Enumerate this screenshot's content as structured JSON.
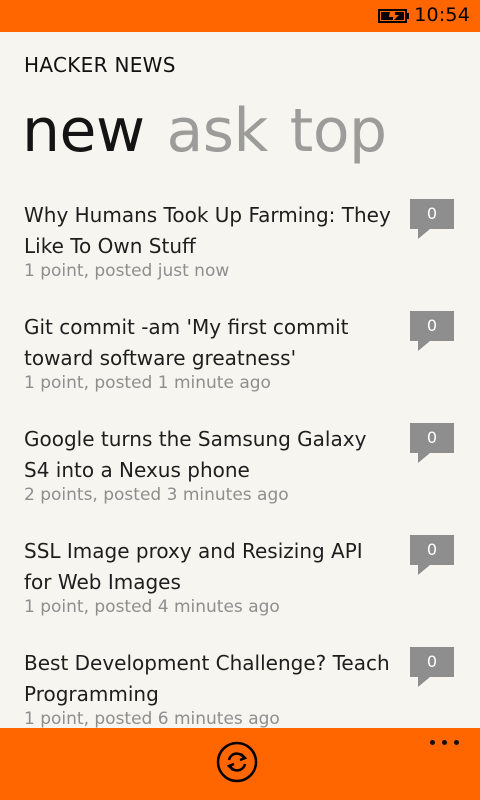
{
  "status_bar": {
    "time": "10:54",
    "battery_icon": "battery-charging-icon",
    "background": "#ff6600"
  },
  "app": {
    "title": "HACKER NEWS"
  },
  "pivot": {
    "tabs": [
      {
        "label": "new",
        "active": true
      },
      {
        "label": "ask",
        "active": false
      },
      {
        "label": "top",
        "active": false
      }
    ]
  },
  "stories": [
    {
      "title": "Why Humans Took Up Farming: They Like To Own Stuff",
      "meta": "1 point, posted just now",
      "comments": "0"
    },
    {
      "title": "Git commit -am 'My first commit toward software greatness'",
      "meta": "1 point, posted 1 minute ago",
      "comments": "0"
    },
    {
      "title": "Google turns the Samsung Galaxy S4 into a Nexus phone",
      "meta": "2 points, posted 3 minutes ago",
      "comments": "0"
    },
    {
      "title": "SSL Image proxy and Resizing API for Web Images",
      "meta": "1 point, posted 4 minutes ago",
      "comments": "0"
    },
    {
      "title": "Best Development Challenge? Teach Programming",
      "meta": "1 point, posted 6 minutes ago",
      "comments": "0"
    }
  ],
  "app_bar": {
    "refresh_icon": "refresh-icon",
    "more_icon": "ellipsis-icon",
    "background": "#ff6600"
  },
  "colors": {
    "accent": "#ff6600",
    "text": "#1e1e1e",
    "muted": "#8e8e8e",
    "background": "#f6f5ef"
  }
}
